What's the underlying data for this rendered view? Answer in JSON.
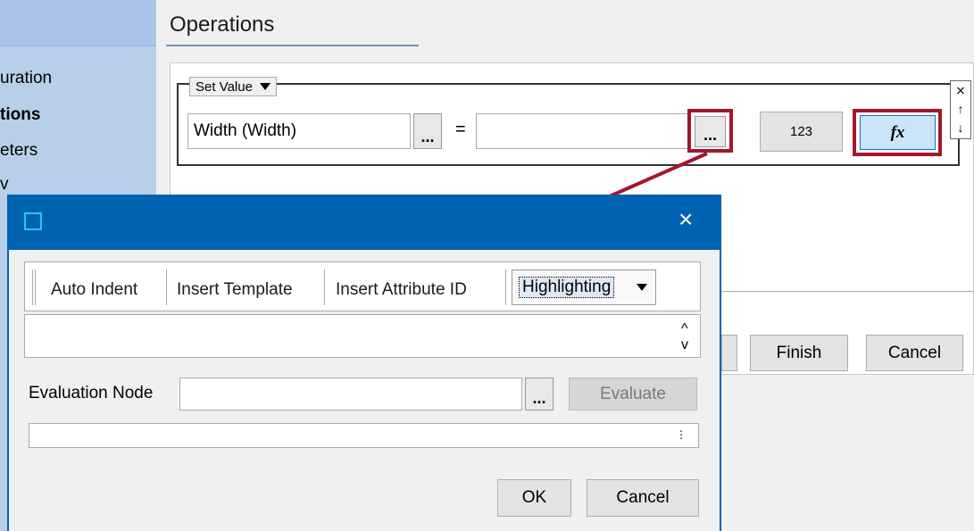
{
  "nav": {
    "items": [
      {
        "label": "uration",
        "bold": false
      },
      {
        "label": "tions",
        "bold": true
      },
      {
        "label": "eters",
        "bold": false
      },
      {
        "label": "v",
        "bold": false
      }
    ]
  },
  "operations": {
    "title": "Operations",
    "mode_select": "Set Value",
    "target_field": "Width (Width)",
    "ellipsis": "...",
    "equals": "=",
    "value_input": "",
    "literal_button": "123",
    "formula_button_icon": "fx",
    "side_controls": [
      "⨯",
      "↑",
      "↓"
    ]
  },
  "footer": {
    "finish": "Finish",
    "cancel": "Cancel"
  },
  "dialog": {
    "title": "",
    "close_glyph": "×",
    "toolbar": {
      "auto_indent": "Auto Indent",
      "insert_template": "Insert Template",
      "insert_attribute_id": "Insert Attribute ID",
      "highlighting": "Highlighting"
    },
    "editor_text": "",
    "evaluation_node_label": "Evaluation Node",
    "evaluation_node_value": "",
    "browse": "...",
    "evaluate": "Evaluate",
    "result_text": "",
    "ok": "OK",
    "cancel": "Cancel"
  },
  "colors": {
    "titlebar": "#0063b1",
    "highlight": "#a3172c",
    "nav_bg": "#b9cfe9"
  }
}
